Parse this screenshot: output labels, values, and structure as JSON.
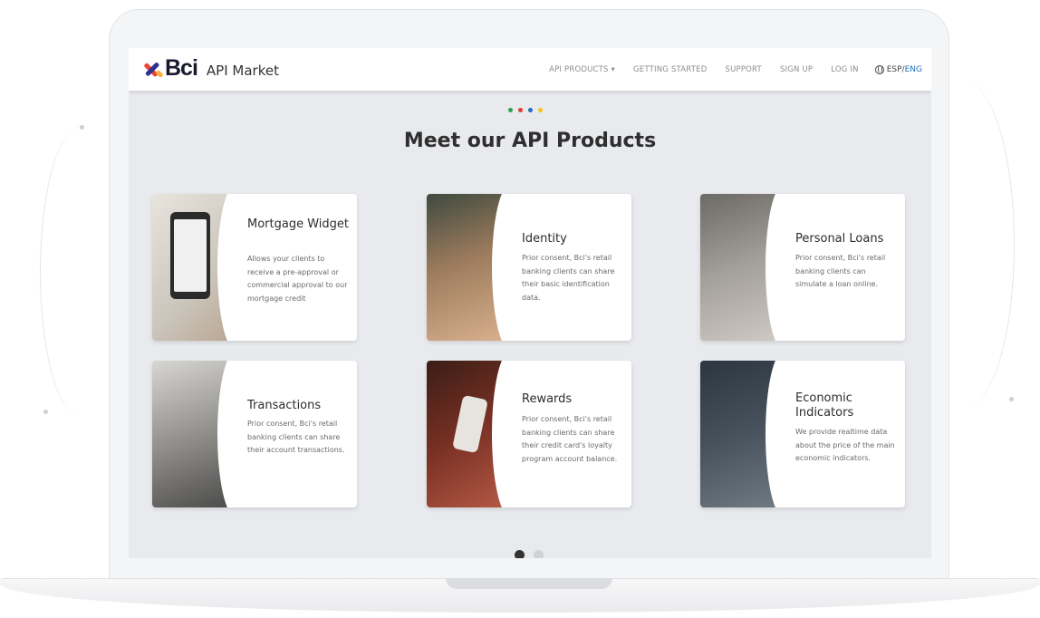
{
  "nav": {
    "logo_text": "Bci",
    "logo_sub": "API Market",
    "links": [
      "API PRODUCTS ▾",
      "GETTING STARTED",
      "SUPPORT",
      "SIGN UP",
      "LOG IN"
    ],
    "lang_esp": "ESP",
    "lang_sep": " / ",
    "lang_eng": "ENG"
  },
  "main": {
    "heading": "Meet our API Products",
    "dot_colors": [
      "#2e9e4f",
      "#e53935",
      "#1e6fb8",
      "#f6c21a"
    ]
  },
  "cards": [
    {
      "title": "Mortgage Widget",
      "desc": "Allows your clients to receive a pre-approval or commercial approval to our mortgage credit",
      "image": "mortgage-phone-image"
    },
    {
      "title": "Identity",
      "desc": "Prior consent, Bci's retail banking clients can share their basic identification data.",
      "image": "identity-woman-image"
    },
    {
      "title": "Personal Loans",
      "desc": "Prior consent, Bci's retail banking clients can simulate a loan online.",
      "image": "personal-loans-woman-image"
    },
    {
      "title": "Transactions",
      "desc": "Prior consent, Bci's retail banking clients can share their account transactions.",
      "image": "transactions-men-image"
    },
    {
      "title": "Rewards",
      "desc": "Prior consent, Bci's retail banking clients can share their credit card's loyalty program account balance.",
      "image": "rewards-card-image"
    },
    {
      "title": "Economic Indicators",
      "desc": "We provide realtime data about the price of the main economic indicators.",
      "image": "economic-indicators-screens-image"
    }
  ],
  "pager": {
    "active_color": "#333333",
    "inactive_color": "#cfd2d6"
  }
}
